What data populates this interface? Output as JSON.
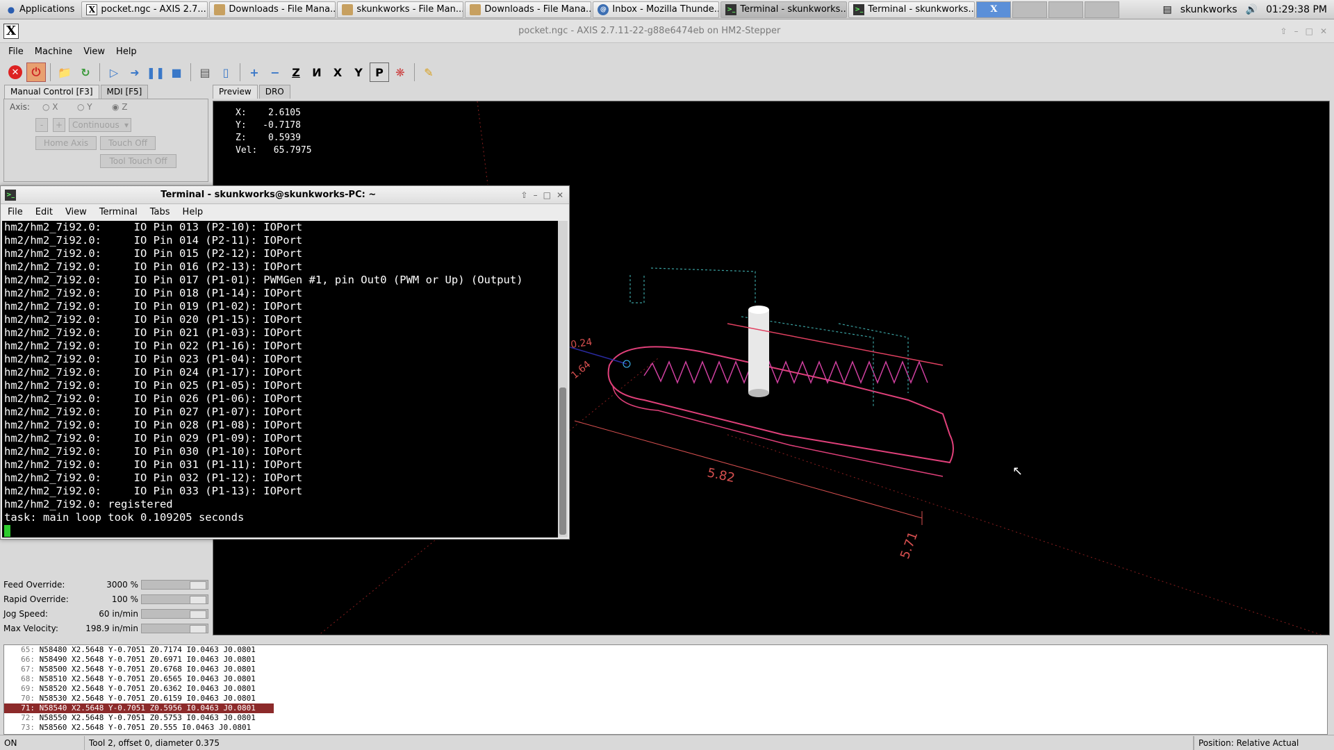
{
  "panel": {
    "apps_label": "Applications",
    "tasks": [
      {
        "label": "pocket.ngc - AXIS 2.7....",
        "icon": "x-icon"
      },
      {
        "label": "Downloads - File Mana...",
        "icon": "folder-icon"
      },
      {
        "label": "skunkworks - File Man...",
        "icon": "folder-icon"
      },
      {
        "label": "Downloads - File Mana...",
        "icon": "folder-icon"
      },
      {
        "label": "Inbox - Mozilla Thunde...",
        "icon": "thunderbird-icon"
      },
      {
        "label": "Terminal - skunkworks...",
        "icon": "terminal-icon"
      },
      {
        "label": "Terminal - skunkworks...",
        "icon": "terminal-icon"
      }
    ],
    "user": "skunkworks",
    "clock": "01:29:38 PM"
  },
  "axis": {
    "title": "pocket.ngc - AXIS 2.7.11-22-g88e6474eb on HM2-Stepper",
    "menu": [
      "File",
      "Machine",
      "View",
      "Help"
    ],
    "tabs": {
      "manual": "Manual Control [F3]",
      "mdi": "MDI [F5]"
    },
    "axis_label": "Axis:",
    "axes": [
      "X",
      "Y",
      "Z"
    ],
    "jog_minus": "-",
    "jog_plus": "+",
    "jog_mode": "Continuous",
    "home_axis": "Home Axis",
    "touch_off": "Touch Off",
    "tool_touch_off": "Tool Touch Off",
    "preview_tabs": {
      "preview": "Preview",
      "dro": "DRO"
    },
    "dro": {
      "x": "X:    2.6105",
      "y": "Y:   -0.7178",
      "z": "Z:    0.5939",
      "vel": "Vel:   65.7975"
    },
    "overrides": [
      {
        "label": "Feed Override:",
        "value": "3000 %"
      },
      {
        "label": "Rapid Override:",
        "value": "100 %"
      },
      {
        "label": "Jog Speed:",
        "value": "60 in/min"
      },
      {
        "label": "Max Velocity:",
        "value": "198.9 in/min"
      }
    ],
    "dimensions": {
      "a": "0.24",
      "b": "1.64",
      "c": "5.82",
      "d": "5.71"
    }
  },
  "terminal": {
    "title": "Terminal - skunkworks@skunkworks-PC: ~",
    "menu": [
      "File",
      "Edit",
      "View",
      "Terminal",
      "Tabs",
      "Help"
    ],
    "lines": [
      "hm2/hm2_7i92.0:     IO Pin 013 (P2-10): IOPort",
      "hm2/hm2_7i92.0:     IO Pin 014 (P2-11): IOPort",
      "hm2/hm2_7i92.0:     IO Pin 015 (P2-12): IOPort",
      "hm2/hm2_7i92.0:     IO Pin 016 (P2-13): IOPort",
      "hm2/hm2_7i92.0:     IO Pin 017 (P1-01): PWMGen #1, pin Out0 (PWM or Up) (Output)",
      "hm2/hm2_7i92.0:     IO Pin 018 (P1-14): IOPort",
      "hm2/hm2_7i92.0:     IO Pin 019 (P1-02): IOPort",
      "hm2/hm2_7i92.0:     IO Pin 020 (P1-15): IOPort",
      "hm2/hm2_7i92.0:     IO Pin 021 (P1-03): IOPort",
      "hm2/hm2_7i92.0:     IO Pin 022 (P1-16): IOPort",
      "hm2/hm2_7i92.0:     IO Pin 023 (P1-04): IOPort",
      "hm2/hm2_7i92.0:     IO Pin 024 (P1-17): IOPort",
      "hm2/hm2_7i92.0:     IO Pin 025 (P1-05): IOPort",
      "hm2/hm2_7i92.0:     IO Pin 026 (P1-06): IOPort",
      "hm2/hm2_7i92.0:     IO Pin 027 (P1-07): IOPort",
      "hm2/hm2_7i92.0:     IO Pin 028 (P1-08): IOPort",
      "hm2/hm2_7i92.0:     IO Pin 029 (P1-09): IOPort",
      "hm2/hm2_7i92.0:     IO Pin 030 (P1-10): IOPort",
      "hm2/hm2_7i92.0:     IO Pin 031 (P1-11): IOPort",
      "hm2/hm2_7i92.0:     IO Pin 032 (P1-12): IOPort",
      "hm2/hm2_7i92.0:     IO Pin 033 (P1-13): IOPort",
      "hm2/hm2_7i92.0: registered",
      "task: main loop took 0.109205 seconds"
    ]
  },
  "gcode": [
    {
      "num": "65:",
      "text": "N58480 X2.5648 Y-0.7051 Z0.7174 I0.0463 J0.0801"
    },
    {
      "num": "66:",
      "text": "N58490 X2.5648 Y-0.7051 Z0.6971 I0.0463 J0.0801"
    },
    {
      "num": "67:",
      "text": "N58500 X2.5648 Y-0.7051 Z0.6768 I0.0463 J0.0801"
    },
    {
      "num": "68:",
      "text": "N58510 X2.5648 Y-0.7051 Z0.6565 I0.0463 J0.0801"
    },
    {
      "num": "69:",
      "text": "N58520 X2.5648 Y-0.7051 Z0.6362 I0.0463 J0.0801"
    },
    {
      "num": "70:",
      "text": "N58530 X2.5648 Y-0.7051 Z0.6159 I0.0463 J0.0801"
    },
    {
      "num": "71:",
      "text": "N58540 X2.5648 Y-0.7051 Z0.5956 I0.0463 J0.0801"
    },
    {
      "num": "72:",
      "text": "N58550 X2.5648 Y-0.7051 Z0.5753 I0.0463 J0.0801"
    },
    {
      "num": "73:",
      "text": "N58560 X2.5648 Y-0.7051 Z0.555 I0.0463 J0.0801"
    }
  ],
  "status": {
    "state": "ON",
    "tool": "Tool 2, offset 0, diameter 0.375",
    "position": "Position: Relative Actual"
  }
}
